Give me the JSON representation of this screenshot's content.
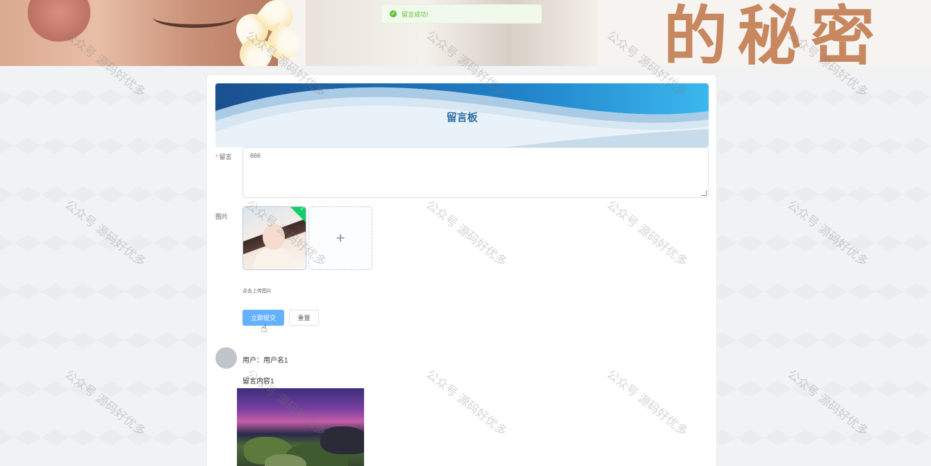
{
  "toast": {
    "message": "留言成功!",
    "icon": "check-circle-icon",
    "color": "#67c23a"
  },
  "banner": {
    "text": "的秘密"
  },
  "board": {
    "title": "留言板",
    "message_label": "留言",
    "message_value": "666",
    "image_label": "图片",
    "upload_tip": "点击上传图片",
    "submit_label": "立即提交",
    "reset_label": "重置"
  },
  "comment": {
    "user": "用户：用户名1",
    "content": "留言内容1"
  },
  "watermark": "公众号 源码好优多",
  "colors": {
    "primary": "#66b1ff",
    "success": "#13ce66",
    "title": "#2a6fa8"
  }
}
